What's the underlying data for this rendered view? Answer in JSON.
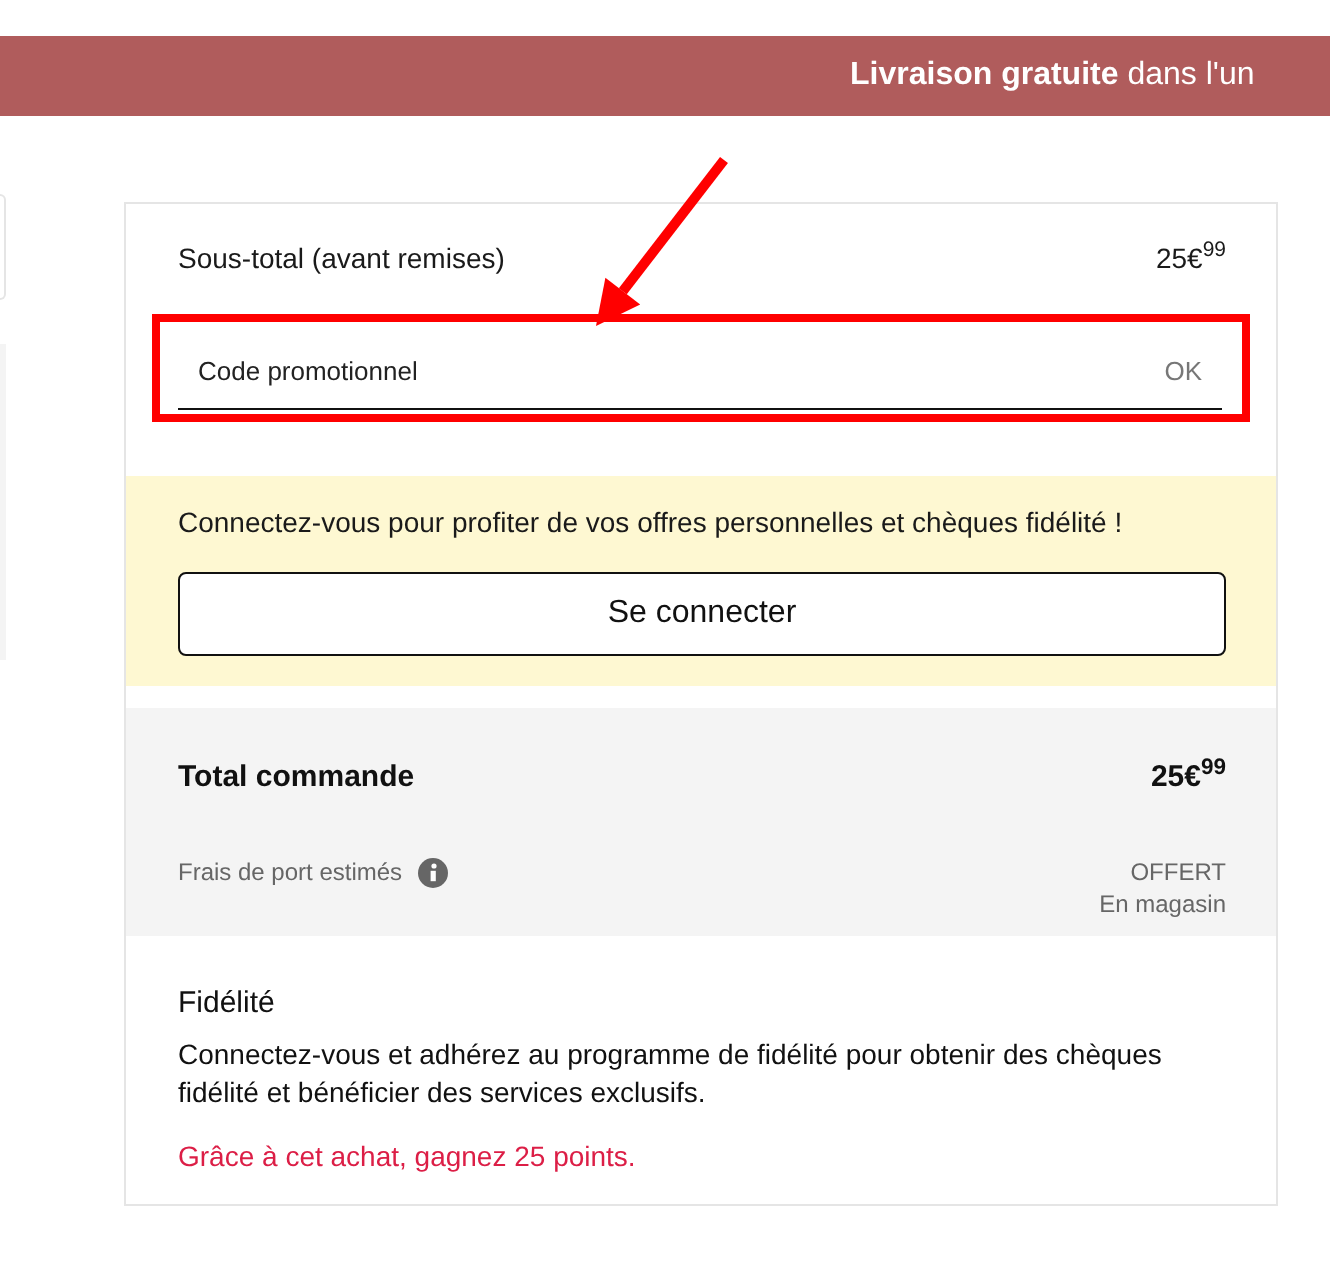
{
  "banner": {
    "text": "**Livraison gratuite** dans l'un"
  },
  "summary": {
    "subtotal": {
      "label": "Sous-total (avant remises)",
      "price": "25€$^{99}$"
    },
    "promo": {
      "placeholder": "Code promotionnel",
      "button": "OK",
      "highlighted": true
    },
    "login": {
      "message": "Connectez-vous pour profiter de vos offres personnelles et chèques fidélité !",
      "button": "Se connecter"
    },
    "total": {
      "label": "Total commande",
      "price": "25€$^{99}$"
    },
    "shipping": {
      "label": "Frais de port estimés",
      "value": "OFFERT",
      "note": "En magasin"
    },
    "loyalty": {
      "title": "Fidélité",
      "text": "Connectez-vous et adhérez au programme de fidélité pour obtenir des chèques fidélité et bénéficier des services exclusifs.",
      "reward": "Grâce à cet achat, gagnez 25 points."
    }
  }
}
